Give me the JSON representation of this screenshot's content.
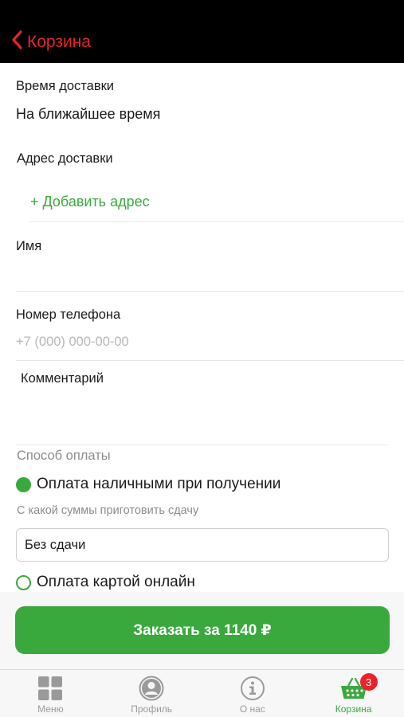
{
  "header": {
    "back_title": "Корзина"
  },
  "delivery_time": {
    "label": "Время доставки",
    "value": "На ближайшее время"
  },
  "address": {
    "label": "Адрес доставки",
    "add_link": "+ Добавить адрес"
  },
  "name": {
    "label": "Имя",
    "value": ""
  },
  "phone": {
    "label": "Номер телефона",
    "placeholder": "+7 (000) 000-00-00"
  },
  "comment": {
    "label": "Комментарий",
    "value": ""
  },
  "payment": {
    "label": "Способ оплаты",
    "options": [
      {
        "label": "Оплата наличными при получении",
        "selected": true
      },
      {
        "label": "Оплата картой онлайн",
        "selected": false
      }
    ],
    "change_label": "С какой суммы приготовить сдачу",
    "change_value": "Без сдачи"
  },
  "order_button": "Заказать за 1140 ₽",
  "tabs": [
    {
      "label": "Меню",
      "icon": "grid-icon"
    },
    {
      "label": "Профиль",
      "icon": "profile-icon"
    },
    {
      "label": "О нас",
      "icon": "info-icon"
    },
    {
      "label": "Корзина",
      "icon": "basket-icon",
      "badge": "3",
      "active": true
    }
  ],
  "colors": {
    "accent": "#3aa93d",
    "header_bg": "#000000",
    "header_text": "#e8242a",
    "badge": "#e8242a"
  }
}
